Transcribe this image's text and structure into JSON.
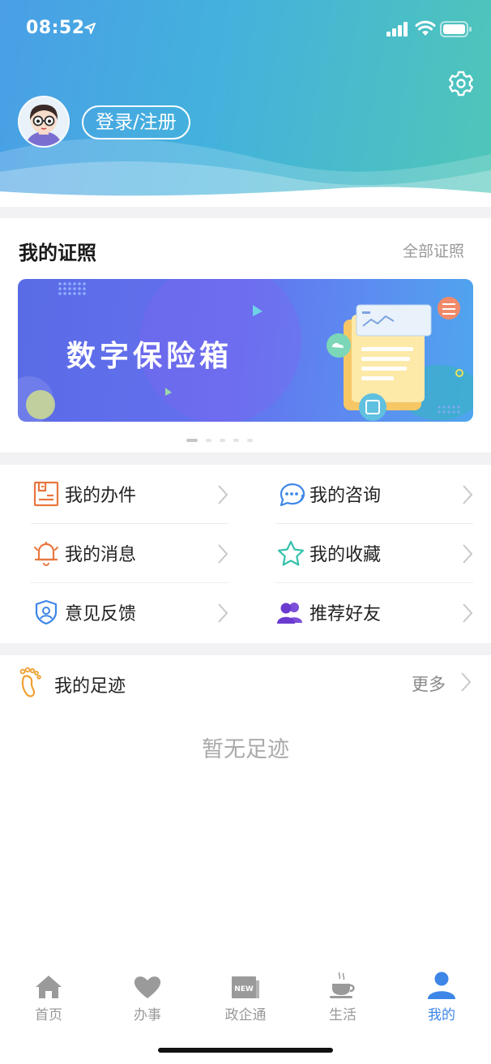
{
  "status_bar": {
    "time": "08:52"
  },
  "header": {
    "login_label": "登录/注册"
  },
  "licenses": {
    "title": "我的证照",
    "all_label": "全部证照",
    "banner_text": "数字保险箱",
    "carousel_count": 5,
    "carousel_active": 0
  },
  "menu": {
    "items": [
      {
        "label": "我的办件",
        "icon": "document-icon"
      },
      {
        "label": "我的咨询",
        "icon": "chat-bubble-icon"
      },
      {
        "label": "我的消息",
        "icon": "bell-icon"
      },
      {
        "label": "我的收藏",
        "icon": "star-icon"
      },
      {
        "label": "意见反馈",
        "icon": "shield-user-icon"
      },
      {
        "label": "推荐好友",
        "icon": "users-icon"
      }
    ]
  },
  "footprints": {
    "title": "我的足迹",
    "more_label": "更多",
    "empty_text": "暂无足迹"
  },
  "tabbar": {
    "items": [
      {
        "label": "首页",
        "icon": "home-icon"
      },
      {
        "label": "办事",
        "icon": "heart-icon"
      },
      {
        "label": "政企通",
        "icon": "news-icon"
      },
      {
        "label": "生活",
        "icon": "coffee-cup-icon"
      },
      {
        "label": "我的",
        "icon": "user-icon"
      }
    ],
    "active_index": 4
  },
  "colors": {
    "accent": "#3d86e8",
    "header_start": "#4a9fe6",
    "header_end": "#4fc6b8",
    "banner": "#6470ee"
  }
}
